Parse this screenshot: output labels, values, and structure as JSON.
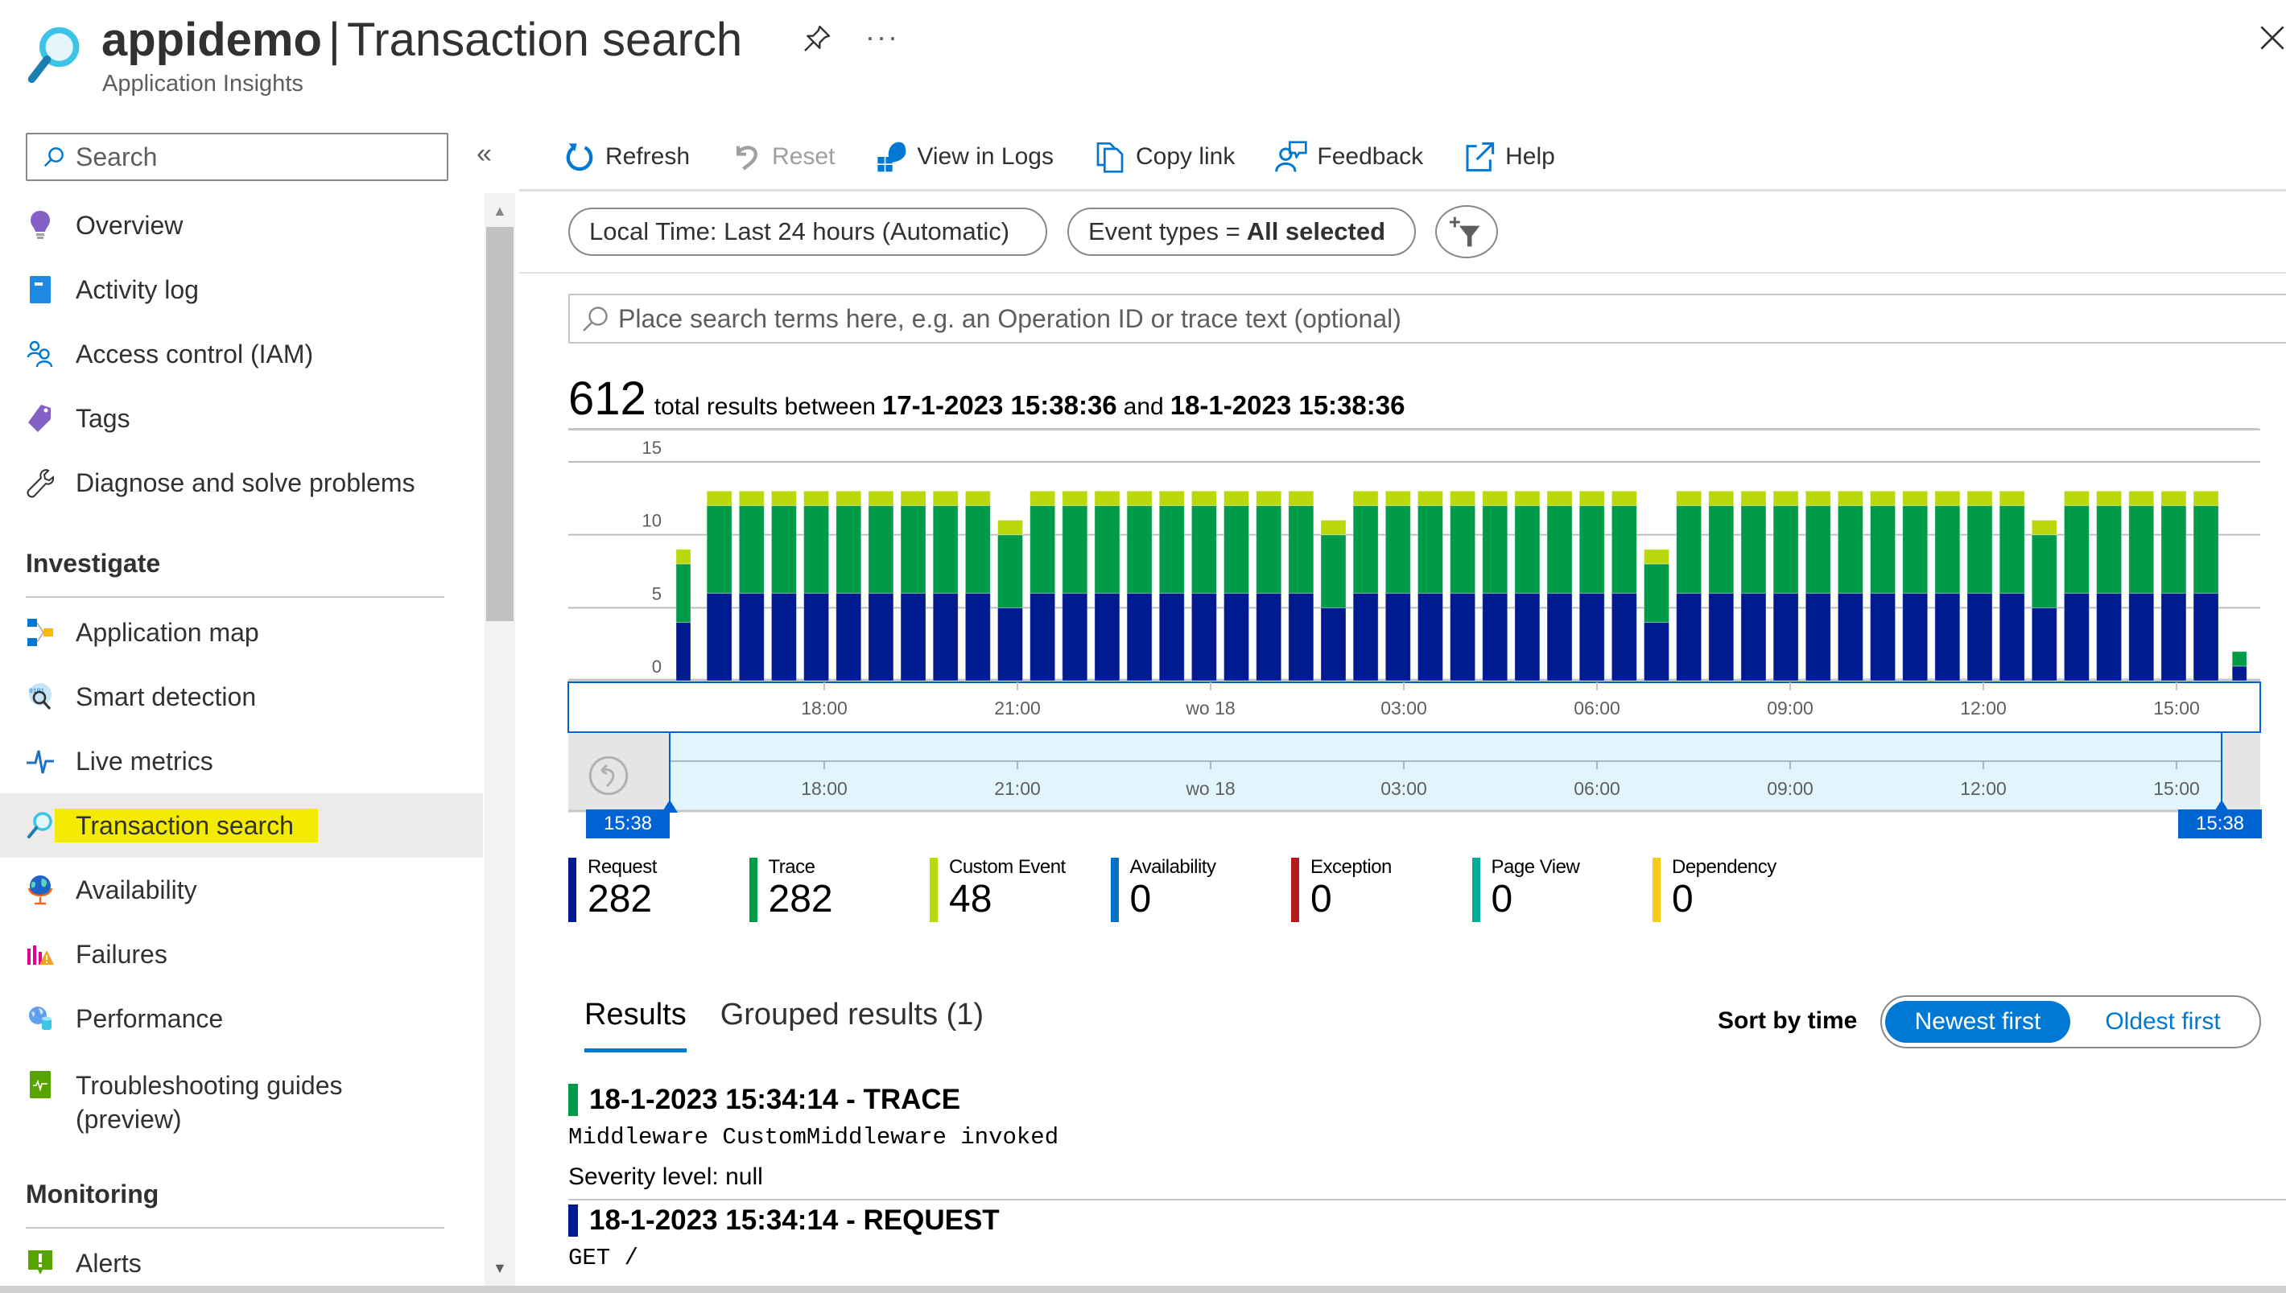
{
  "header": {
    "resource_name": "appidemo",
    "separator": "|",
    "page_title": "Transaction search",
    "subtitle": "Application Insights",
    "more_label": "···"
  },
  "sidebar": {
    "search_placeholder": "Search",
    "collapse_label": "«",
    "items_top": [
      {
        "label": "Overview",
        "icon": "lightbulb-icon"
      },
      {
        "label": "Activity log",
        "icon": "activity-log-icon"
      },
      {
        "label": "Access control (IAM)",
        "icon": "people-icon"
      },
      {
        "label": "Tags",
        "icon": "tag-icon"
      },
      {
        "label": "Diagnose and solve problems",
        "icon": "wrench-icon"
      }
    ],
    "section_investigate": "Investigate",
    "items_investigate": [
      {
        "label": "Application map",
        "icon": "application-map-icon"
      },
      {
        "label": "Smart detection",
        "icon": "smart-detection-icon"
      },
      {
        "label": "Live metrics",
        "icon": "pulse-icon"
      },
      {
        "label": "Transaction search",
        "icon": "search-icon",
        "active": true
      },
      {
        "label": "Availability",
        "icon": "globe-icon"
      },
      {
        "label": "Failures",
        "icon": "failures-icon"
      },
      {
        "label": "Performance",
        "icon": "performance-icon"
      },
      {
        "label": "Troubleshooting guides",
        "label2": "(preview)",
        "icon": "guide-book-icon"
      }
    ],
    "section_monitoring": "Monitoring",
    "items_monitoring": [
      {
        "label": "Alerts",
        "icon": "alert-icon"
      }
    ]
  },
  "toolbar": {
    "refresh": "Refresh",
    "reset": "Reset",
    "view_in_logs": "View in Logs",
    "copy_link": "Copy link",
    "feedback": "Feedback",
    "help": "Help"
  },
  "filters": {
    "time_range": "Local Time: Last 24 hours (Automatic)",
    "event_types_label": "Event types =",
    "event_types_value": "All selected"
  },
  "search": {
    "placeholder": "Place search terms here, e.g. an Operation ID or trace text (optional)",
    "value": ""
  },
  "summary": {
    "count": "612",
    "text_between": "total results between",
    "start": "17-1-2023 15:38:36",
    "text_and": "and",
    "end": "18-1-2023 15:38:36"
  },
  "brush": {
    "start_label": "15:38",
    "end_label": "15:38"
  },
  "colors": {
    "request": "#001a8f",
    "trace": "#009b48",
    "custom_event": "#bad80a",
    "availability": "#0072c6",
    "exception": "#b4191c",
    "page_view": "#00ad96",
    "dependency": "#f7cc18",
    "accent": "#0078d4"
  },
  "chart_data": {
    "type": "bar",
    "stacked": true,
    "title": "",
    "xlabel": "",
    "ylabel": "",
    "ylim": [
      0,
      15
    ],
    "yticks": [
      0,
      5,
      10,
      15
    ],
    "grid": true,
    "x_range": [
      "17-1-2023 15:38",
      "18-1-2023 15:38"
    ],
    "xtick_labels": [
      "18:00",
      "21:00",
      "wo 18",
      "03:00",
      "06:00",
      "09:00",
      "12:00",
      "15:00"
    ],
    "bin_minutes": 30,
    "series": [
      {
        "name": "Request",
        "values": [
          4,
          6,
          6,
          6,
          6,
          6,
          6,
          6,
          6,
          6,
          5,
          6,
          6,
          6,
          6,
          6,
          6,
          6,
          6,
          6,
          5,
          6,
          6,
          6,
          6,
          6,
          6,
          6,
          6,
          6,
          4,
          6,
          6,
          6,
          6,
          6,
          6,
          6,
          6,
          6,
          6,
          6,
          5,
          6,
          6,
          6,
          6,
          6,
          1
        ]
      },
      {
        "name": "Trace",
        "values": [
          4,
          6,
          6,
          6,
          6,
          6,
          6,
          6,
          6,
          6,
          5,
          6,
          6,
          6,
          6,
          6,
          6,
          6,
          6,
          6,
          5,
          6,
          6,
          6,
          6,
          6,
          6,
          6,
          6,
          6,
          4,
          6,
          6,
          6,
          6,
          6,
          6,
          6,
          6,
          6,
          6,
          6,
          5,
          6,
          6,
          6,
          6,
          6,
          1
        ]
      },
      {
        "name": "Custom Event",
        "values": [
          1,
          1,
          1,
          1,
          1,
          1,
          1,
          1,
          1,
          1,
          1,
          1,
          1,
          1,
          1,
          1,
          1,
          1,
          1,
          1,
          1,
          1,
          1,
          1,
          1,
          1,
          1,
          1,
          1,
          1,
          1,
          1,
          1,
          1,
          1,
          1,
          1,
          1,
          1,
          1,
          1,
          1,
          1,
          1,
          1,
          1,
          1,
          1,
          0
        ]
      }
    ]
  },
  "legend": [
    {
      "name": "Request",
      "value": "282",
      "color_key": "request"
    },
    {
      "name": "Trace",
      "value": "282",
      "color_key": "trace"
    },
    {
      "name": "Custom Event",
      "value": "48",
      "color_key": "custom_event"
    },
    {
      "name": "Availability",
      "value": "0",
      "color_key": "availability"
    },
    {
      "name": "Exception",
      "value": "0",
      "color_key": "exception"
    },
    {
      "name": "Page View",
      "value": "0",
      "color_key": "page_view"
    },
    {
      "name": "Dependency",
      "value": "0",
      "color_key": "dependency"
    }
  ],
  "results_tabs": {
    "results": "Results",
    "grouped": "Grouped results (1)"
  },
  "sort": {
    "label": "Sort by time",
    "newest": "Newest first",
    "oldest": "Oldest first",
    "selected": "newest"
  },
  "results": [
    {
      "title": "18-1-2023 15:34:14 - TRACE",
      "type": "trace",
      "line1": "Middleware CustomMiddleware invoked",
      "line2": "Severity level: null"
    },
    {
      "title": "18-1-2023 15:34:14 - REQUEST",
      "type": "request",
      "line1": "GET /"
    }
  ]
}
